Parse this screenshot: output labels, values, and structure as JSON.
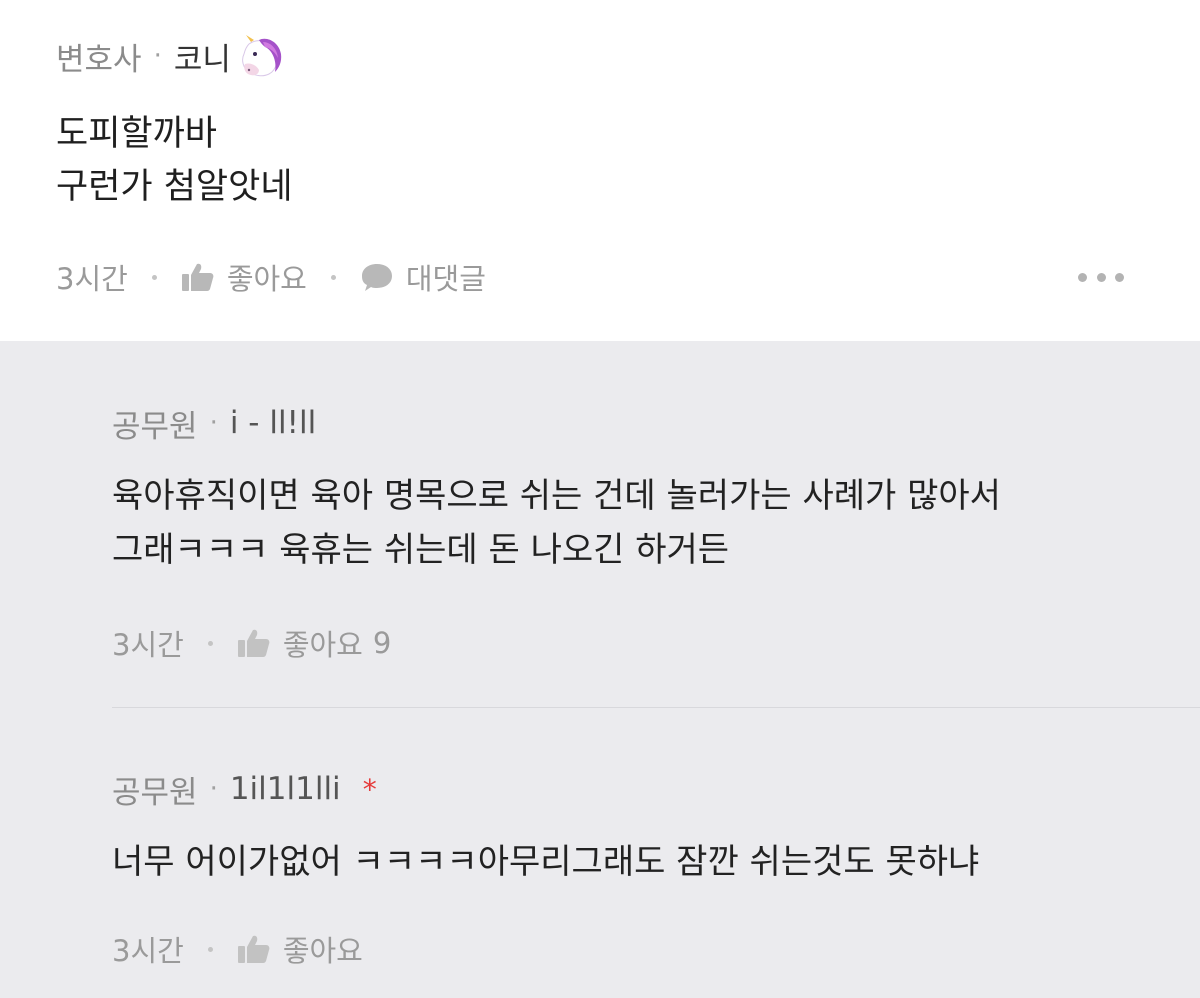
{
  "top_comment": {
    "role": "변호사",
    "separator": "·",
    "nickname": "코니",
    "lines": [
      "도피할까바",
      "구런가 첨알앗네"
    ],
    "time": "3시간",
    "like_label": "좋아요",
    "reply_label": "대댓글"
  },
  "replies": [
    {
      "role": "공무원",
      "separator": "·",
      "nickname": "i - ll!ll",
      "lines": [
        "육아휴직이면 육아 명목으로 쉬는 건데 놀러가는 사례가 많아서",
        "그래ㅋㅋㅋ 육휴는 쉬는데 돈 나오긴 하거든"
      ],
      "time": "3시간",
      "like_label": "좋아요",
      "like_count": "9"
    },
    {
      "role": "공무원",
      "separator": "·",
      "nickname": "1il1l1lli",
      "badge": "*",
      "lines": [
        "너무 어이가없어 ㅋㅋㅋㅋ아무리그래도 잠깐 쉬는것도 못하냐"
      ],
      "time": "3시간",
      "like_label": "좋아요"
    }
  ],
  "icons": {
    "unicorn": "unicorn-emoji",
    "like": "thumbs-up-icon",
    "reply": "speech-bubble-icon",
    "more": "more-options-icon"
  },
  "colors": {
    "reply_background": "#ebebee",
    "badge_red": "#e53a3a",
    "meta_gray": "#9a9a9a"
  }
}
